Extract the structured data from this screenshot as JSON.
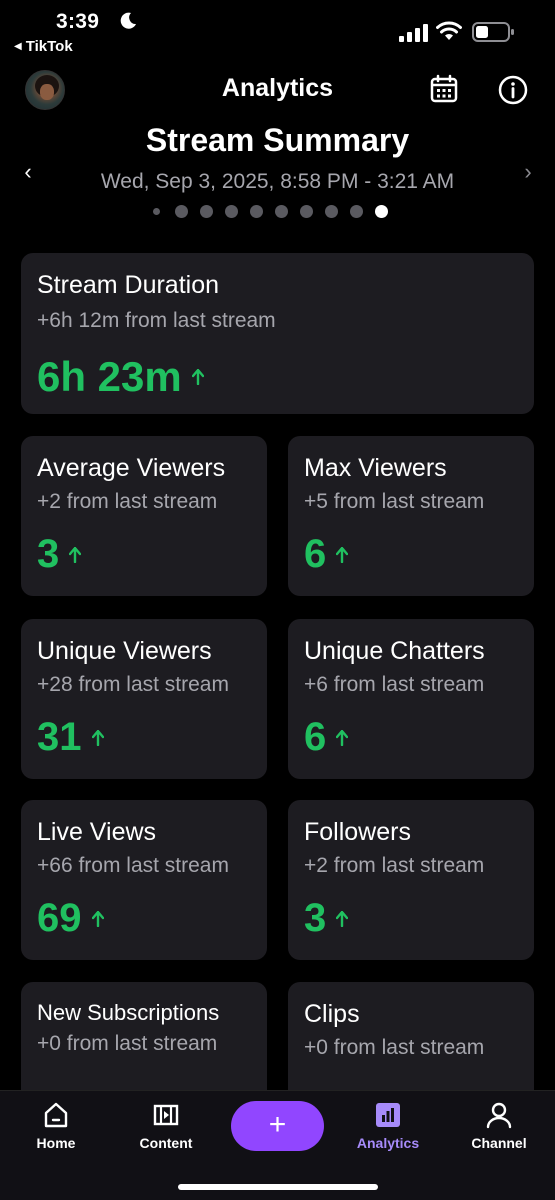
{
  "status_bar": {
    "time": "3:39",
    "back_app": "TikTok"
  },
  "header": {
    "title": "Analytics"
  },
  "summary": {
    "title": "Stream Summary",
    "date_range": "Wed, Sep 3, 2025, 8:58 PM - 3:21 AM",
    "page_count": 10,
    "active_page": 10
  },
  "cards": {
    "stream_duration": {
      "label": "Stream Duration",
      "change": "+6h 12m from last stream",
      "value": "6h 23m"
    },
    "average_viewers": {
      "label": "Average Viewers",
      "change": "+2 from last stream",
      "value": "3"
    },
    "max_viewers": {
      "label": "Max Viewers",
      "change": "+5 from last stream",
      "value": "6"
    },
    "unique_viewers": {
      "label": "Unique Viewers",
      "change": "+28 from last stream",
      "value": "31"
    },
    "unique_chatters": {
      "label": "Unique Chatters",
      "change": "+6 from last stream",
      "value": "6"
    },
    "live_views": {
      "label": "Live Views",
      "change": "+66 from last stream",
      "value": "69"
    },
    "followers": {
      "label": "Followers",
      "change": "+2 from last stream",
      "value": "3"
    },
    "new_subscriptions": {
      "label": "New Subscriptions",
      "change": "+0 from last stream"
    },
    "clips": {
      "label": "Clips",
      "change": "+0 from last stream"
    }
  },
  "nav": {
    "home": "Home",
    "content": "Content",
    "create": "+",
    "analytics": "Analytics",
    "channel": "Channel"
  },
  "colors": {
    "background": "#000000",
    "card": "#1d1c21",
    "positive": "#20c060",
    "accent": "#9146ff",
    "active_tab": "#a78bfa"
  },
  "icons": {
    "calendar": "calendar-icon",
    "info": "info-icon",
    "home": "home-icon",
    "content": "content-icon",
    "analytics": "analytics-icon",
    "channel": "channel-icon",
    "trend": "arrow-up-icon"
  }
}
